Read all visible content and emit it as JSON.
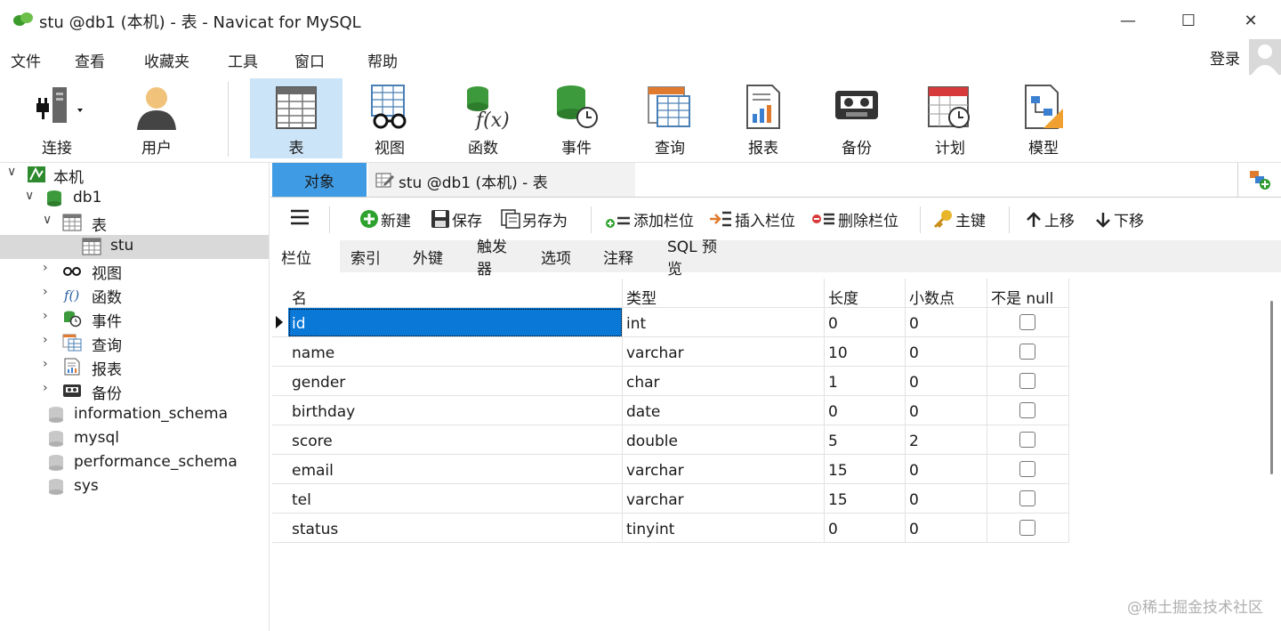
{
  "window": {
    "title": "stu @db1 (本机) - 表 - Navicat for MySQL"
  },
  "menu": [
    "文件",
    "查看",
    "收藏夹",
    "工具",
    "窗口",
    "帮助"
  ],
  "account": {
    "login_label": "登录"
  },
  "toolbar": {
    "items": [
      {
        "label": "连接",
        "icon": "connection-plug-icon"
      },
      {
        "label": "用户",
        "icon": "user-icon"
      },
      {
        "label": "表",
        "icon": "table-icon",
        "active": true
      },
      {
        "label": "视图",
        "icon": "view-glasses-icon"
      },
      {
        "label": "函数",
        "icon": "function-icon"
      },
      {
        "label": "事件",
        "icon": "event-clock-icon"
      },
      {
        "label": "查询",
        "icon": "query-icon"
      },
      {
        "label": "报表",
        "icon": "report-icon"
      },
      {
        "label": "备份",
        "icon": "backup-tape-icon"
      },
      {
        "label": "计划",
        "icon": "schedule-calendar-icon"
      },
      {
        "label": "模型",
        "icon": "model-icon"
      }
    ]
  },
  "tree": [
    {
      "label": "本机",
      "icon": "connection-icon",
      "expanded": true
    },
    {
      "label": "db1",
      "icon": "database-icon",
      "expanded": true
    },
    {
      "label": "表",
      "icon": "tables-folder-icon",
      "expanded": true
    },
    {
      "label": "stu",
      "icon": "table-icon",
      "selected": true
    },
    {
      "label": "视图",
      "icon": "views-icon"
    },
    {
      "label": "函数",
      "icon": "functions-icon"
    },
    {
      "label": "事件",
      "icon": "events-icon"
    },
    {
      "label": "查询",
      "icon": "queries-icon"
    },
    {
      "label": "报表",
      "icon": "reports-icon"
    },
    {
      "label": "备份",
      "icon": "backups-icon"
    },
    {
      "label": "information_schema",
      "icon": "database-gray-icon"
    },
    {
      "label": "mysql",
      "icon": "database-gray-icon"
    },
    {
      "label": "performance_schema",
      "icon": "database-gray-icon"
    },
    {
      "label": "sys",
      "icon": "database-gray-icon"
    }
  ],
  "tabs": {
    "objects_label": "对象",
    "doc_label": "stu @db1 (本机) - 表"
  },
  "actions": {
    "new": "新建",
    "save": "保存",
    "save_as": "另存为",
    "add_field": "添加栏位",
    "insert_field": "插入栏位",
    "delete_field": "删除栏位",
    "primary_key": "主键",
    "move_up": "上移",
    "move_down": "下移"
  },
  "subtabs": [
    "栏位",
    "索引",
    "外键",
    "触发器",
    "选项",
    "注释",
    "SQL 预览"
  ],
  "columns": [
    "名",
    "类型",
    "长度",
    "小数点",
    "不是 null"
  ],
  "rows": [
    {
      "name": "id",
      "type": "int",
      "length": "0",
      "decimals": "0",
      "not_null": false
    },
    {
      "name": "name",
      "type": "varchar",
      "length": "10",
      "decimals": "0",
      "not_null": false
    },
    {
      "name": "gender",
      "type": "char",
      "length": "1",
      "decimals": "0",
      "not_null": false
    },
    {
      "name": "birthday",
      "type": "date",
      "length": "0",
      "decimals": "0",
      "not_null": false
    },
    {
      "name": "score",
      "type": "double",
      "length": "5",
      "decimals": "2",
      "not_null": false
    },
    {
      "name": "email",
      "type": "varchar",
      "length": "15",
      "decimals": "0",
      "not_null": false
    },
    {
      "name": "tel",
      "type": "varchar",
      "length": "15",
      "decimals": "0",
      "not_null": false
    },
    {
      "name": "status",
      "type": "tinyint",
      "length": "0",
      "decimals": "0",
      "not_null": false
    }
  ],
  "watermark": "@稀土掘金技术社区",
  "colors": {
    "accent": "#3f9be4",
    "selection": "#0a78d7",
    "active_tool": "#cce4f7"
  }
}
